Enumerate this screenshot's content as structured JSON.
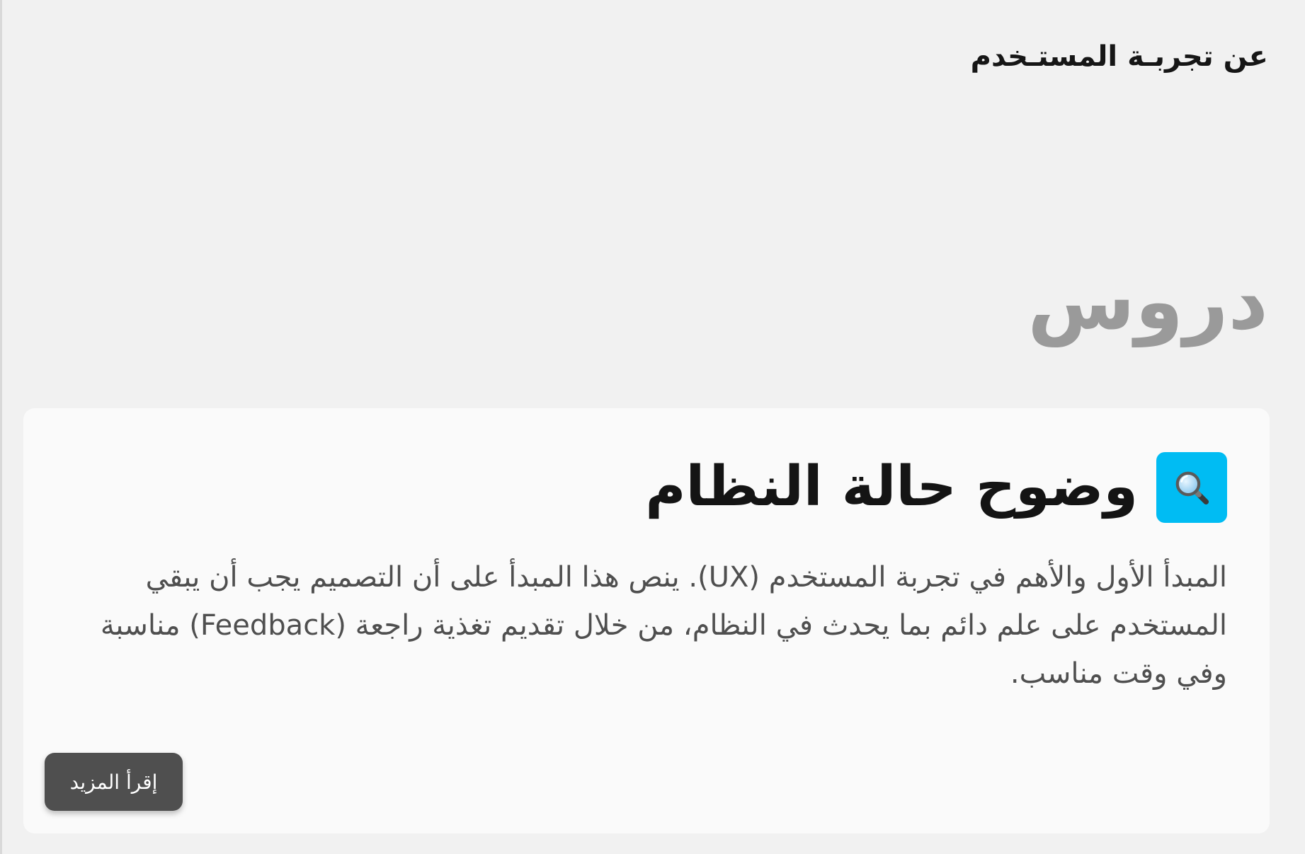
{
  "header": {
    "brand": "عن تجربـة المستـخدم"
  },
  "section": {
    "title": "دروس"
  },
  "card": {
    "icon": "magnifying-glass-icon",
    "icon_bg_color": "#00bcf3",
    "title": "وضوح حالة النظام",
    "text": "المبدأ الأول والأهم في تجربة المستخدم (UX). ينص هذا المبدأ على أن التصميم يجب أن يبقي المستخدم على علم دائم بما يحدث في النظام، من خلال تقديم تغذية راجعة (Feedback) مناسبة وفي وقت مناسب.",
    "button_label": "إقرأ المزيد",
    "button_color": "#4f4f4f"
  }
}
